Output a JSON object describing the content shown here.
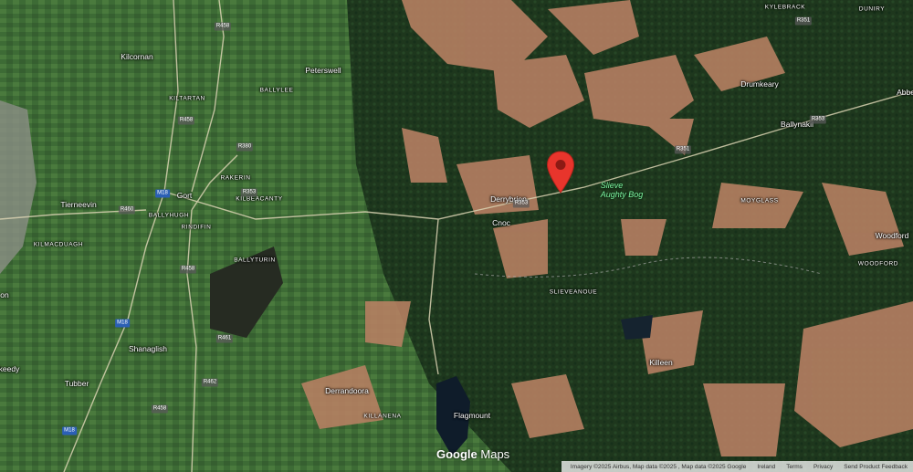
{
  "map": {
    "provider_logo": {
      "part1": "Google",
      "part2": " Maps"
    },
    "places": [
      {
        "name": "Kilcornan",
        "kind": "place"
      },
      {
        "name": "Peterswell",
        "kind": "place"
      },
      {
        "name": "KILTARTAN",
        "kind": "caps"
      },
      {
        "name": "BALLYLEE",
        "kind": "caps"
      },
      {
        "name": "KYLEBRACK",
        "kind": "caps"
      },
      {
        "name": "DUNIRY",
        "kind": "caps"
      },
      {
        "name": "Drumkeary",
        "kind": "place"
      },
      {
        "name": "Abbe",
        "kind": "place"
      },
      {
        "name": "Ballynakil",
        "kind": "place"
      },
      {
        "name": "RAKERIN",
        "kind": "caps"
      },
      {
        "name": "KILBEACANTY",
        "kind": "caps"
      },
      {
        "name": "Gort",
        "kind": "place"
      },
      {
        "name": "Tierneevin",
        "kind": "place"
      },
      {
        "name": "BALLYHUGH",
        "kind": "caps"
      },
      {
        "name": "RINDIFIN",
        "kind": "caps"
      },
      {
        "name": "KILMACDUAGH",
        "kind": "caps"
      },
      {
        "name": "Derrybrien",
        "kind": "place"
      },
      {
        "name": "Cnoc",
        "kind": "place"
      },
      {
        "name": "Slieve",
        "kind": "water"
      },
      {
        "name": "Aughty Bog",
        "kind": "water"
      },
      {
        "name": "MOYGLASS",
        "kind": "caps"
      },
      {
        "name": "Woodford",
        "kind": "place"
      },
      {
        "name": "WOODFORD",
        "kind": "caps"
      },
      {
        "name": "BALLYTURIN",
        "kind": "caps"
      },
      {
        "name": "SLIEVEANOUE",
        "kind": "caps"
      },
      {
        "name": "on",
        "kind": "place"
      },
      {
        "name": "Shanaglish",
        "kind": "place"
      },
      {
        "name": "Killeen",
        "kind": "place"
      },
      {
        "name": "keedy",
        "kind": "place"
      },
      {
        "name": "Tubber",
        "kind": "place"
      },
      {
        "name": "Derrandoora",
        "kind": "place"
      },
      {
        "name": "KILLANENA",
        "kind": "caps"
      },
      {
        "name": "Flagmount",
        "kind": "place"
      }
    ],
    "roads": [
      {
        "label": "R458",
        "kind": "regional"
      },
      {
        "label": "R351",
        "kind": "regional"
      },
      {
        "label": "R458",
        "kind": "regional"
      },
      {
        "label": "R380",
        "kind": "regional"
      },
      {
        "label": "R353",
        "kind": "regional"
      },
      {
        "label": "R351",
        "kind": "regional"
      },
      {
        "label": "R460",
        "kind": "regional"
      },
      {
        "label": "R353",
        "kind": "regional"
      },
      {
        "label": "R458",
        "kind": "regional"
      },
      {
        "label": "R461",
        "kind": "regional"
      },
      {
        "label": "R462",
        "kind": "regional"
      },
      {
        "label": "R458",
        "kind": "regional"
      },
      {
        "label": "R353",
        "kind": "regional"
      },
      {
        "label": "M18",
        "kind": "motorway"
      },
      {
        "label": "M18",
        "kind": "motorway"
      },
      {
        "label": "M18",
        "kind": "motorway"
      }
    ],
    "attribution": {
      "imagery": "Imagery ©2025 Airbus, Map data ©2025 , Map data ©2025 Google",
      "country": "Ireland",
      "terms": "Terms",
      "privacy": "Privacy",
      "feedback": "Send Product Feedback"
    },
    "colors": {
      "pin": "#e8352c",
      "land": "#2f5a2c",
      "bog": "#b57f62",
      "forest": "#1f3a1e",
      "water": "#0f1c2a"
    }
  }
}
